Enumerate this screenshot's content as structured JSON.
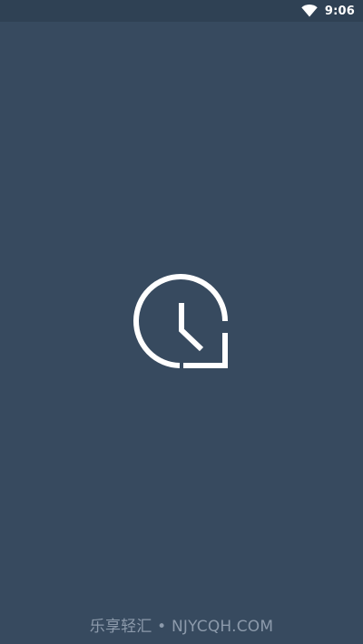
{
  "status_bar": {
    "time": "9:06",
    "wifi_icon": "wifi-icon"
  },
  "logo": {
    "icon": "clock-chat-icon",
    "color": "#ffffff"
  },
  "footer": {
    "text": "乐享轻汇 • NJYCQH.COM"
  },
  "colors": {
    "background": "#374a5f",
    "status_bar": "#2f4154",
    "footer_text": "#8c9aab"
  }
}
